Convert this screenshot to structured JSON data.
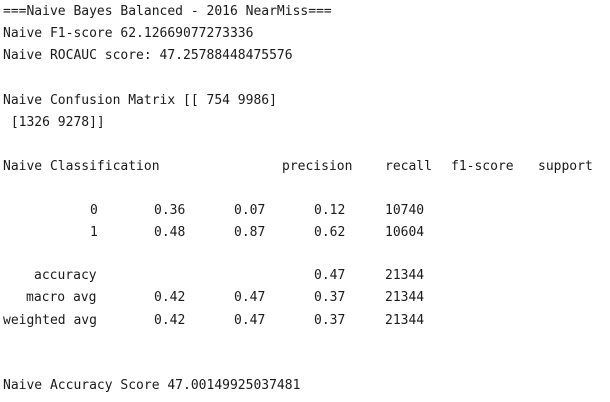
{
  "console": {
    "header": "===Naive Bayes Balanced - 2016 NearMiss===",
    "f1_line": "Naive F1-score 62.12669077273336",
    "rocauc_line": "Naive ROCAUC score: 47.25788448475576",
    "confusion_line_1": "Naive Confusion Matrix [[ 754 9986]",
    "confusion_line_2": " [1326 9278]]",
    "classification_title": "Naive Classification",
    "columns": {
      "precision": "precision",
      "recall": "recall",
      "f1": "f1-score",
      "support": "support"
    },
    "rows": [
      {
        "label": "0",
        "precision": "0.36",
        "recall": "0.07",
        "f1": "0.12",
        "support": "10740"
      },
      {
        "label": "1",
        "precision": "0.48",
        "recall": "0.87",
        "f1": "0.62",
        "support": "10604"
      },
      {
        "label": "accuracy",
        "precision": "",
        "recall": "",
        "f1": "0.47",
        "support": "21344"
      },
      {
        "label": "macro avg",
        "precision": "0.42",
        "recall": "0.47",
        "f1": "0.37",
        "support": "21344"
      },
      {
        "label": "weighted avg",
        "precision": "0.42",
        "recall": "0.47",
        "f1": "0.37",
        "support": "21344"
      }
    ],
    "accuracy_score_line": "Naive Accuracy Score 47.00149925037481"
  }
}
